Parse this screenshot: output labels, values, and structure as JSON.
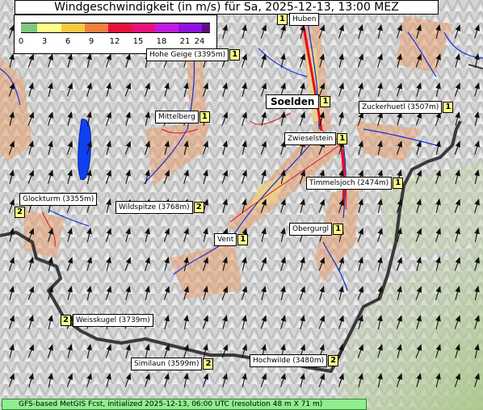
{
  "title": "Windgeschwindigkeit (in m/s) für Sa, 2025-12-13, 13:00 MEZ",
  "legend": {
    "ticks": [
      "0",
      "3",
      "6",
      "9",
      "12",
      "15",
      "18",
      "21",
      "24"
    ],
    "colors": [
      "#7ec87e",
      "#ffff88",
      "#f5c842",
      "#f08040",
      "#e8103a",
      "#e8107a",
      "#c01ce0",
      "#9010e0",
      "#601080"
    ]
  },
  "places": [
    {
      "id": "huben",
      "label": "Huben",
      "badge": "1"
    },
    {
      "id": "hohe-geige",
      "label": "Hohe Geige (3395m)",
      "badge": "1"
    },
    {
      "id": "soelden",
      "label": "Soelden",
      "badge": "1"
    },
    {
      "id": "zuckerhuetl",
      "label": "Zuckerhuetl (3507m)",
      "badge": "1"
    },
    {
      "id": "mittelberg",
      "label": "Mittelberg",
      "badge": "1"
    },
    {
      "id": "zwieselstein",
      "label": "Zwieselstein",
      "badge": "1"
    },
    {
      "id": "timmelsjoch",
      "label": "Timmelsjoch (2474m)",
      "badge": "1"
    },
    {
      "id": "glockturm",
      "label": "Glockturm (3355m)",
      "badge": "2"
    },
    {
      "id": "wildspitze",
      "label": "Wildspitze (3768m)",
      "badge": "2"
    },
    {
      "id": "vent",
      "label": "Vent",
      "badge": "1"
    },
    {
      "id": "obergurgl",
      "label": "Obergurgl",
      "badge": "1"
    },
    {
      "id": "weisskugel",
      "label": "Weisskugel (3739m)",
      "badge": "2"
    },
    {
      "id": "similaun",
      "label": "Similaun (3599m)",
      "badge": "2"
    },
    {
      "id": "hochwilde",
      "label": "Hochwilde (3480m)",
      "badge": "2"
    }
  ],
  "footer": "GFS-based MetGIS Fcst, initialized 2025-12-13, 06:00 UTC  (resolution 48 m X 71 m)"
}
